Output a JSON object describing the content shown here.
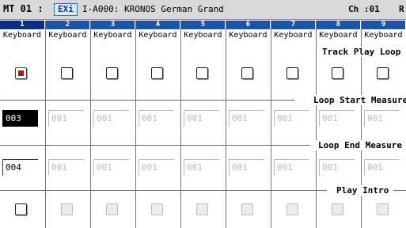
{
  "header": {
    "mode": "MT 01 :",
    "bank_badge": "EXi",
    "program": "I-A000: KRONOS German Grand",
    "channel": "Ch :01",
    "right_clip": "R"
  },
  "tracks": [
    {
      "num": "1",
      "instrument": "Keyboard",
      "loop": true,
      "loop_start": "003",
      "loop_end": "004"
    },
    {
      "num": "2",
      "instrument": "Keyboard",
      "loop": false,
      "loop_start": "001",
      "loop_end": "001"
    },
    {
      "num": "3",
      "instrument": "Keyboard",
      "loop": false,
      "loop_start": "001",
      "loop_end": "001"
    },
    {
      "num": "4",
      "instrument": "Keyboard",
      "loop": false,
      "loop_start": "001",
      "loop_end": "001"
    },
    {
      "num": "5",
      "instrument": "Keyboard",
      "loop": false,
      "loop_start": "001",
      "loop_end": "001"
    },
    {
      "num": "6",
      "instrument": "Keyboard",
      "loop": false,
      "loop_start": "001",
      "loop_end": "001"
    },
    {
      "num": "7",
      "instrument": "Keyboard",
      "loop": false,
      "loop_start": "001",
      "loop_end": "001"
    },
    {
      "num": "8",
      "instrument": "Keyboard",
      "loop": false,
      "loop_start": "001",
      "loop_end": "001"
    },
    {
      "num": "9",
      "instrument": "Keyboard",
      "loop": false,
      "loop_start": "001",
      "loop_end": "001"
    }
  ],
  "labels": {
    "track_play_loop": "Track Play Loop",
    "loop_start_measure": "Loop Start Measure",
    "loop_end_measure": "Loop End Measure",
    "play_intro": "Play Intro"
  },
  "colors": {
    "track_header": "#1e53a8",
    "checked": "#a81a1a",
    "selected_field": "#000000"
  }
}
